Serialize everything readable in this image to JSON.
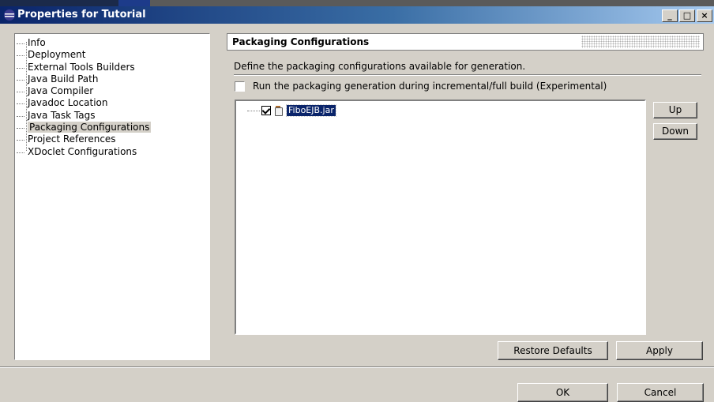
{
  "window": {
    "title": "Properties for Tutorial",
    "buttons": {
      "minimize": "_",
      "maximize": "□",
      "close": "×"
    }
  },
  "sidebar": {
    "items": [
      {
        "label": "Info"
      },
      {
        "label": "Deployment"
      },
      {
        "label": "External Tools Builders"
      },
      {
        "label": "Java Build Path"
      },
      {
        "label": "Java Compiler"
      },
      {
        "label": "Javadoc Location"
      },
      {
        "label": "Java Task Tags"
      },
      {
        "label": "Packaging Configurations",
        "selected": true
      },
      {
        "label": "Project References"
      },
      {
        "label": "XDoclet Configurations"
      }
    ]
  },
  "page": {
    "title": "Packaging Configurations",
    "description": "Define the packaging configurations available for generation.",
    "incremental_checkbox": {
      "label": "Run the packaging generation during incremental/full build (Experimental)",
      "checked": false
    },
    "configs": [
      {
        "name": "FiboEJB.jar",
        "checked": true
      }
    ],
    "buttons": {
      "up": "Up",
      "down": "Down",
      "restore": "Restore Defaults",
      "apply": "Apply"
    }
  },
  "dialog": {
    "ok": "OK",
    "cancel": "Cancel"
  },
  "colors": {
    "titlebar_start": "#0a246a",
    "titlebar_end": "#a6caf0",
    "selection": "#0a246a",
    "face": "#d4d0c8"
  }
}
